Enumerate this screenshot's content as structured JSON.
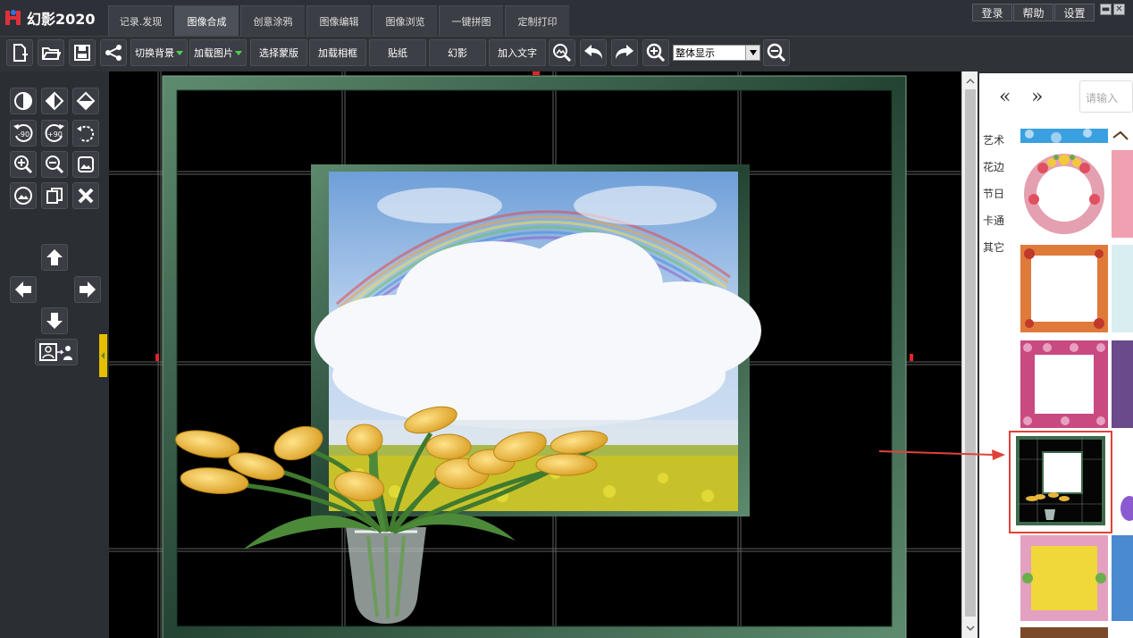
{
  "app": {
    "title": "幻影2020"
  },
  "tabs": [
    {
      "label": "记录.发现"
    },
    {
      "label": "图像合成"
    },
    {
      "label": "创意涂鸦"
    },
    {
      "label": "图像编辑"
    },
    {
      "label": "图像浏览"
    },
    {
      "label": "一键拼图"
    },
    {
      "label": "定制打印"
    }
  ],
  "active_tab": "图像合成",
  "account": {
    "login": "登录",
    "help": "帮助",
    "settings": "设置"
  },
  "window_controls": {
    "minimize": "▬",
    "close": "✕"
  },
  "toolbar": {
    "switch_bg": "切换背景",
    "load_image": "加载图片",
    "select_mask": "选择蒙版",
    "load_frame": "加载相框",
    "sticker": "贴纸",
    "phantom": "幻影",
    "add_text": "加入文字",
    "zoom_value": "整体显示"
  },
  "left_tools": {
    "rotate_minus": "-90",
    "rotate_plus": "+90"
  },
  "right_panel": {
    "prev": "«",
    "next": "»",
    "search_placeholder": "请输入",
    "categories": [
      "艺术",
      "花边",
      "节日",
      "卡通",
      "其它"
    ]
  },
  "colors": {
    "accent_yellow": "#e6c000",
    "highlight_red": "#e0423a",
    "frame_green": "#2f5a3f"
  }
}
